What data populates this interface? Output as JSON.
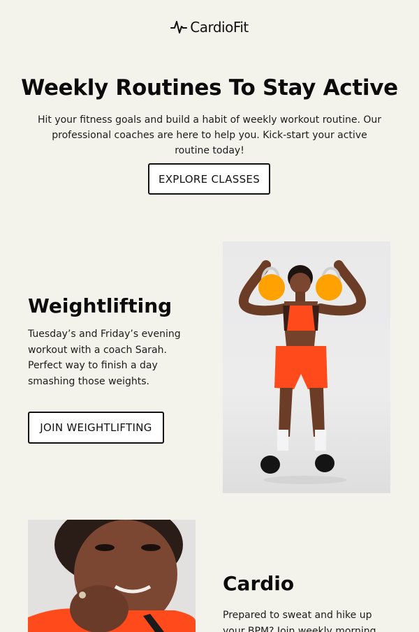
{
  "brand": {
    "name": "CardioFit",
    "icon": "heartbeat-pulse-icon"
  },
  "hero": {
    "title": "Weekly Routines To Stay Active",
    "text": "Hit your fitness goals and build a habit of weekly workout routine. Our professional coaches are here to help you. Kick-start your active routine today!",
    "button_label": "EXPLORE CLASSES"
  },
  "weightlifting": {
    "title": "Weightlifting",
    "text": "Tuesday’s and Friday’s evening workout with a coach Sarah. Perfect way to finish a day smashing those weights.",
    "button_label": "JOIN WEIGHTLIFTING"
  },
  "cardio": {
    "title": "Cardio",
    "text": "Prepared to sweat and hike up your BPM? Join weekly morning Cardio"
  },
  "colors": {
    "background": "#f3f2eb",
    "button_bg": "#ffffff",
    "text": "#111111",
    "accent_orange": "#ff4a1c",
    "kettlebell": "#ffa100"
  }
}
